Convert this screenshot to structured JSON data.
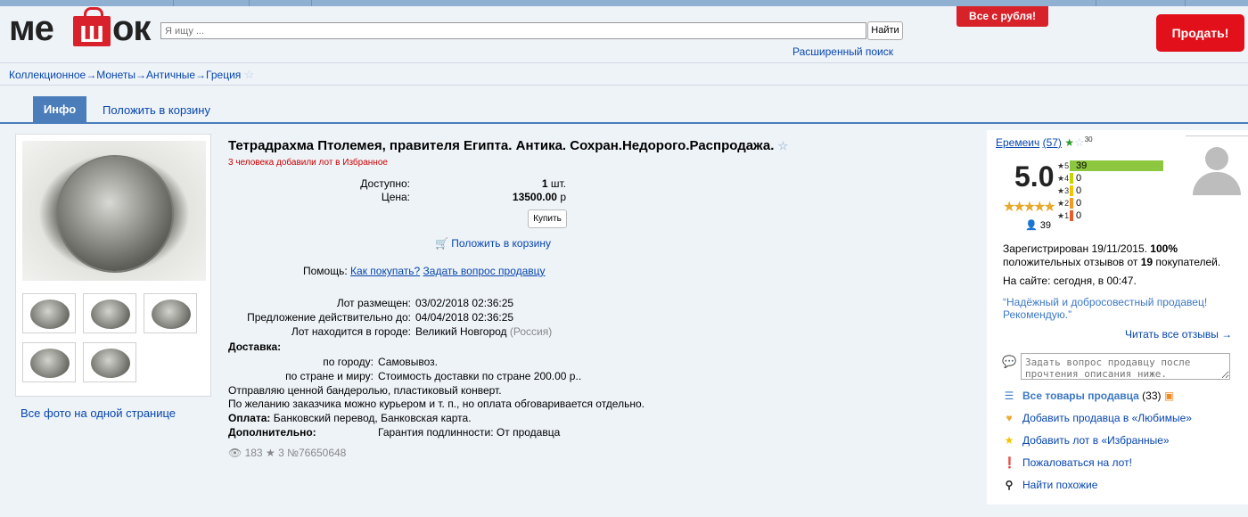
{
  "header": {
    "logo_text": "мешок",
    "search_placeholder": "Я ищу ...",
    "search_button": "Найти",
    "advanced_search": "Расширенный поиск",
    "promo": "Все с рубля!",
    "sell_button": "Продать!"
  },
  "breadcrumb": [
    "Коллекционное",
    "Монеты",
    "Античные",
    "Греция"
  ],
  "tabs": {
    "info": "Инфо",
    "add_to_cart": "Положить в корзину"
  },
  "gallery": {
    "all_photos_link": "Все фото на одной странице"
  },
  "lot": {
    "title": "Тетрадрахма Птолемея, правителя Египта. Антика. Сохран.Недорого.Распродажа.",
    "favorites_note": "3 человека добавили лот в Избранное",
    "available_label": "Доступно:",
    "available_value": "1",
    "available_unit": "шт.",
    "price_label": "Цена:",
    "price_value": "13500.00",
    "price_currency": "р",
    "buy_button": "Купить",
    "add_to_cart": "Положить в корзину",
    "help_label": "Помощь:",
    "help_link_how": "Как покупать?",
    "help_link_ask": "Задать вопрос продавцу",
    "placed_label": "Лот размещен:",
    "placed_value": "03/02/2018 02:36:25",
    "valid_label": "Предложение действительно до:",
    "valid_value": "04/04/2018 02:36:25",
    "city_label": "Лот находится в городе:",
    "city_value": "Великий Новгород",
    "country": "(Россия)",
    "delivery_label": "Доставка:",
    "delivery_city_label": "по городу:",
    "delivery_city_value": "Самовывоз.",
    "delivery_country_label": "по стране и миру:",
    "delivery_country_value": "Стоимость доставки по стране 200.00 р..",
    "delivery_note_1": "Отправляю ценной бандеролью, пластиковый конверт.",
    "delivery_note_2": "По желанию заказчика можно курьером и т. п., но оплата обговаривается отдельно.",
    "payment_label": "Оплата:",
    "payment_value": "Банковский перевод, Банковская карта.",
    "extra_label": "Дополнительно:",
    "extra_value": "Гарантия подлинности: От продавца",
    "views": "183",
    "fav_count": "3",
    "lot_number": "№76650648"
  },
  "seller": {
    "name": "Еремеич",
    "reviews_count": "(57)",
    "badge_count": "30",
    "rating": "5.0",
    "rating_people": "39",
    "distribution": [
      {
        "stars": "5",
        "count": "39",
        "fraction": 1.0,
        "color": "#8dc63f"
      },
      {
        "stars": "4",
        "count": "0",
        "fraction": 0.0,
        "color": "#c8d400"
      },
      {
        "stars": "3",
        "count": "0",
        "fraction": 0.0,
        "color": "#f5c400"
      },
      {
        "stars": "2",
        "count": "0",
        "fraction": 0.0,
        "color": "#f39a1f"
      },
      {
        "stars": "1",
        "count": "0",
        "fraction": 0.0,
        "color": "#ea5a2a"
      }
    ],
    "registered_line_1": "Зарегистрирован 19/11/2015.",
    "registered_percent": "100%",
    "registered_line_2": "положительных отзывов от",
    "registered_buyers": "19",
    "registered_line_3": "покупателей.",
    "online": "На сайте: сегодня, в 00:47.",
    "quote": "“Надёжный и добросовестный продавец! Рекомендую.”",
    "read_reviews": "Читать все отзывы →",
    "ask_placeholder": "Задать вопрос продавцу после прочтения описания ниже.",
    "actions": [
      {
        "label": "Все товары продавца",
        "extra": "(33)",
        "icon": "list-icon",
        "color": "#3b78c4"
      },
      {
        "label": "Добавить продавца в «Любимые»",
        "icon": "heart-icon",
        "color": "#f0a830"
      },
      {
        "label": "Добавить лот в «Избранные»",
        "icon": "star-icon",
        "color": "#f5c400"
      },
      {
        "label": "Пожаловаться на лот!",
        "icon": "alert-icon",
        "color": "#d8212a"
      },
      {
        "label": "Найти похожие",
        "icon": "search-icon",
        "color": "#222"
      }
    ]
  }
}
